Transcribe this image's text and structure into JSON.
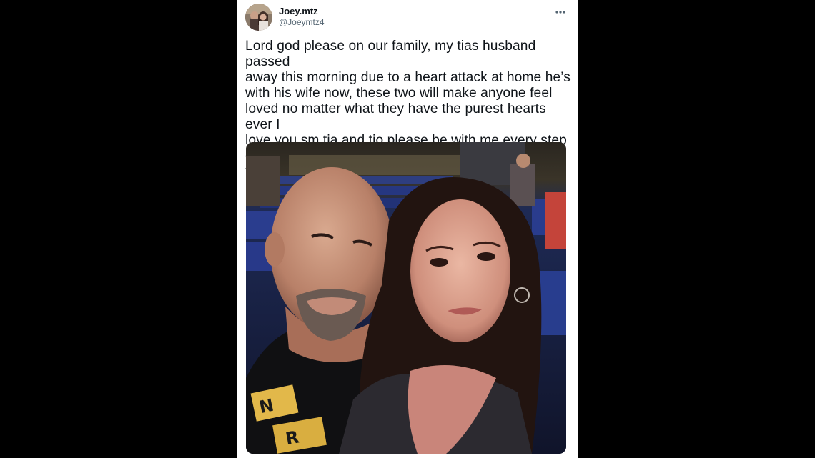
{
  "tweet": {
    "author": {
      "display_name": "Joey.mtz",
      "handle": "@Joeymtz4",
      "avatar_icon": "user-avatar-photo"
    },
    "more_icon": "more-horizontal-icon",
    "text": "Lord god please on our family, my tias husband passed\naway this morning due to a heart attack at home he’s\nwith his wife now, these two will make anyone feel\nloved no matter what they have the purest hearts ever I\nlove you sm tia and tio please be with me every step of\nthe way",
    "media": {
      "kind": "photo",
      "shirt_print": "N R"
    }
  },
  "colors": {
    "background": "#000000",
    "card": "#ffffff",
    "text_primary": "#0f1419",
    "text_secondary": "#536471"
  }
}
